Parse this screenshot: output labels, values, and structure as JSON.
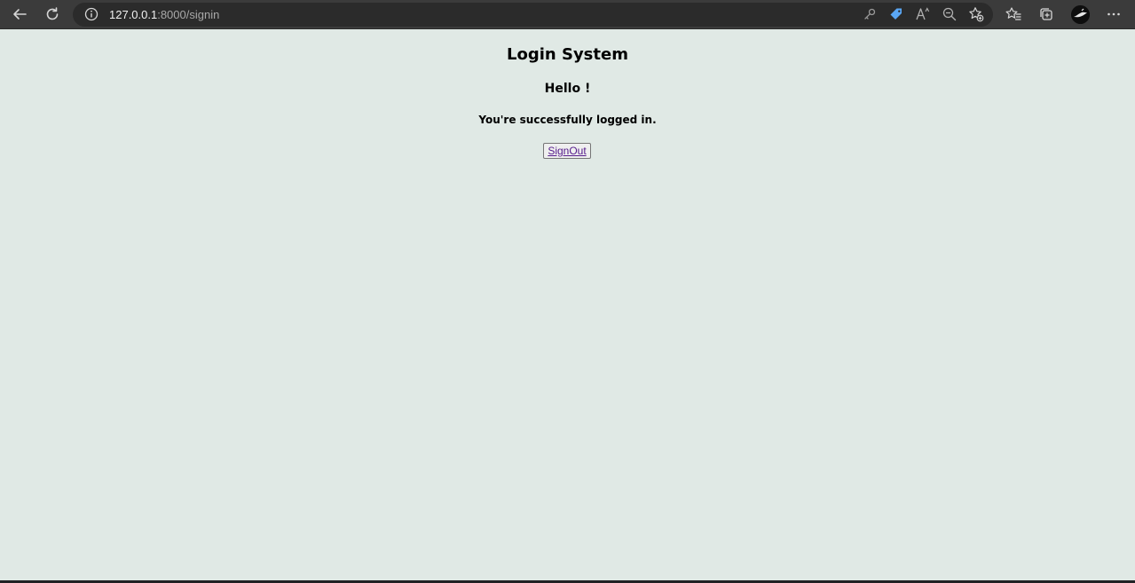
{
  "browser": {
    "url_host": "127.0.0.1",
    "url_path": ":8000/signin",
    "icons": {
      "back": "back-arrow-icon",
      "refresh": "refresh-icon",
      "site_info": "info-icon",
      "password_key": "key-icon",
      "coupon_tag": "tag-icon",
      "read_aloud": "read-aloud-icon",
      "zoom": "zoom-out-icon",
      "add_favorite": "add-favorite-icon",
      "favorites": "favorites-icon",
      "collections": "collections-icon",
      "profile": "avatar",
      "menu": "more-icon"
    },
    "colors": {
      "toolbar": "#3b3b3b",
      "address_bar": "#2b2b2b",
      "tag_icon": "#5aa7f5"
    }
  },
  "page": {
    "title": "Login System",
    "greeting": "Hello !",
    "status": "You're successfully logged in.",
    "signout_label": "SignOut",
    "colors": {
      "background": "#e0e9e5",
      "link": "#551a8b"
    }
  }
}
